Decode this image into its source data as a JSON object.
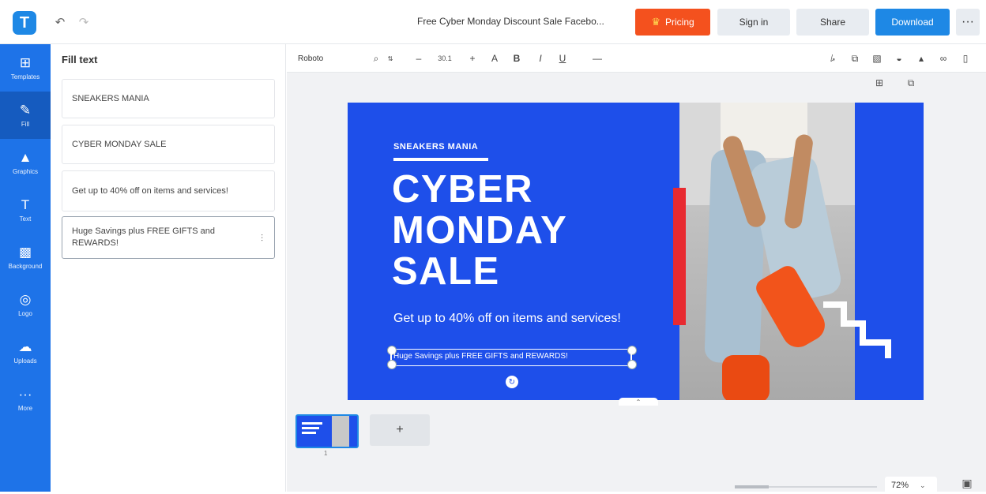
{
  "app": {
    "logo_letter": "T",
    "document_title": "Free Cyber Monday Discount Sale Facebo...",
    "accent_color": "#1e88e5",
    "pricing_color": "#f4511e"
  },
  "topbar": {
    "undo_icon": "undo-icon",
    "redo_icon": "redo-icon",
    "pricing_label": "Pricing",
    "signin_label": "Sign in",
    "share_label": "Share",
    "download_label": "Download",
    "more_label": "···"
  },
  "rail": {
    "items": [
      {
        "label": "Templates",
        "icon": "⊞",
        "icon_name": "templates-icon"
      },
      {
        "label": "Fill",
        "icon": "✎",
        "icon_name": "pencil-icon"
      },
      {
        "label": "Graphics",
        "icon": "▲",
        "icon_name": "graphics-icon"
      },
      {
        "label": "Text",
        "icon": "T",
        "icon_name": "text-icon"
      },
      {
        "label": "Background",
        "icon": "▩",
        "icon_name": "background-icon"
      },
      {
        "label": "Logo",
        "icon": "◎",
        "icon_name": "logo-icon"
      },
      {
        "label": "Uploads",
        "icon": "☁",
        "icon_name": "upload-icon"
      },
      {
        "label": "More",
        "icon": "···",
        "icon_name": "more-icon"
      }
    ]
  },
  "panel": {
    "title": "Fill text",
    "fields": [
      "SNEAKERS MANIA",
      "CYBER MONDAY SALE",
      "Get up to 40% off on items and services!",
      "Huge Savings plus FREE GIFTS and REWARDS!"
    ]
  },
  "format_bar": {
    "font_family": "Roboto",
    "font_size": "30.1",
    "minus": "–",
    "plus": "+",
    "text_color": "A",
    "bold": "B",
    "italic": "I",
    "underline": "U",
    "more": "—"
  },
  "design": {
    "eyebrow": "SNEAKERS MANIA",
    "headline_1": "CYBER",
    "headline_2": "MONDAY",
    "headline_3": "SALE",
    "subtitle": "Get up to 40% off on items and services!",
    "promo": "Huge Savings plus FREE GIFTS and REWARDS!",
    "background_color": "#1e4fea",
    "accent_red": "#e82a30"
  },
  "pages": {
    "page_number": "1",
    "add_label": "+"
  },
  "zoom": {
    "value": "72%",
    "level": 0.24
  }
}
